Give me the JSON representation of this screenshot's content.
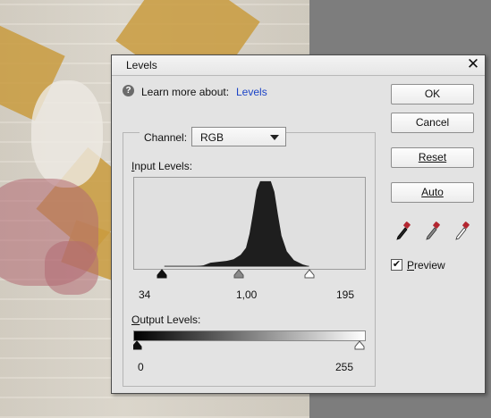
{
  "dialog": {
    "title": "Levels",
    "close_glyph": "✕",
    "learn_text": "Learn more about:",
    "learn_link": "Levels",
    "help_glyph": "?"
  },
  "buttons": {
    "ok": "OK",
    "cancel": "Cancel",
    "reset": "Reset",
    "auto": "Auto"
  },
  "eyedroppers": [
    "black-point-eyedropper-icon",
    "gray-point-eyedropper-icon",
    "white-point-eyedropper-icon"
  ],
  "preview": {
    "label": "Preview",
    "checked": true,
    "check_glyph": "✔"
  },
  "channel": {
    "label": "Channel:",
    "value": "RGB"
  },
  "input_levels": {
    "label": "Input Levels:",
    "black": "34",
    "midtone": "1,00",
    "white": "195"
  },
  "output_levels": {
    "label": "Output Levels:",
    "black": "0",
    "white": "255"
  },
  "colors": {
    "accent_link": "#1c44c7",
    "histogram_fill": "#1e1e1e",
    "dialog_bg": "#e3e3e3"
  }
}
